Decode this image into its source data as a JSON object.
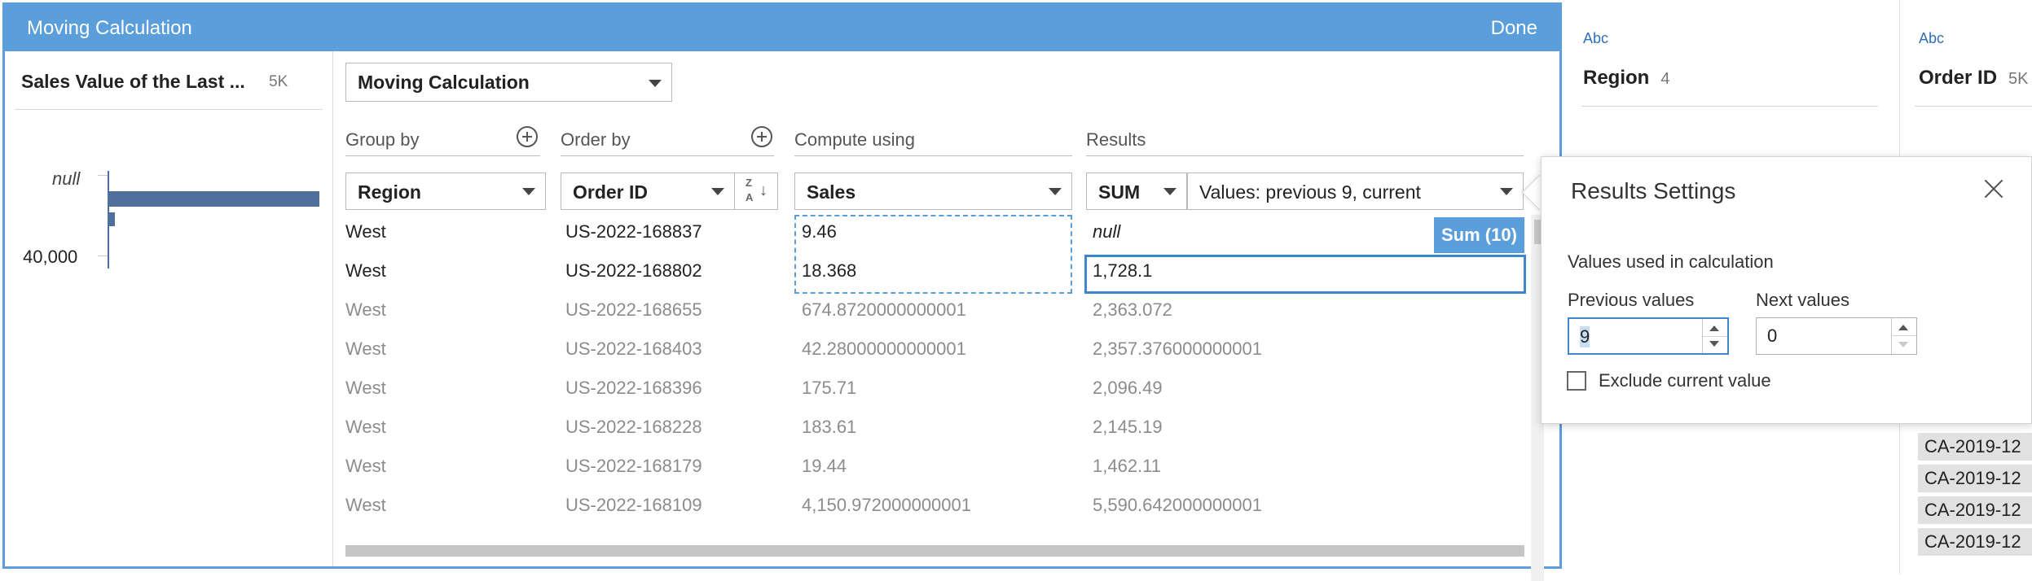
{
  "editor": {
    "title": "Moving Calculation",
    "done_label": "Done",
    "left_panel": {
      "field_name": "Sales Value of the Last ...",
      "count": "5K",
      "null_label": "null",
      "axis_label": "40,000",
      "histogram": {
        "null_bar": 1.0,
        "bar_2": 0.025
      }
    },
    "calc_type": "Moving Calculation",
    "columns": {
      "group_by": "Group by",
      "order_by": "Order by",
      "compute_using": "Compute using",
      "results": "Results"
    },
    "dropdowns": {
      "group_by": "Region",
      "order_by": "Order ID",
      "compute_using": "Sales",
      "aggregation": "SUM",
      "values": "Values: previous 9, current"
    },
    "sort_icon": "sort-z-a-icon",
    "sort_z": "Z",
    "sort_a": "A",
    "sum_badge": "Sum (10)",
    "rows": [
      {
        "region": "West",
        "order_id": "US-2022-168837",
        "sales": "9.46",
        "result": "null"
      },
      {
        "region": "West",
        "order_id": "US-2022-168802",
        "sales": "18.368",
        "result": "1,728.1"
      },
      {
        "region": "West",
        "order_id": "US-2022-168655",
        "sales": "674.8720000000001",
        "result": "2,363.072"
      },
      {
        "region": "West",
        "order_id": "US-2022-168403",
        "sales": "42.28000000000001",
        "result": "2,357.376000000001"
      },
      {
        "region": "West",
        "order_id": "US-2022-168396",
        "sales": "175.71",
        "result": "2,096.49"
      },
      {
        "region": "West",
        "order_id": "US-2022-168228",
        "sales": "183.61",
        "result": "2,145.19"
      },
      {
        "region": "West",
        "order_id": "US-2022-168179",
        "sales": "19.44",
        "result": "1,462.11"
      },
      {
        "region": "West",
        "order_id": "US-2022-168109",
        "sales": "4,150.972000000001",
        "result": "5,590.642000000001"
      }
    ]
  },
  "background_cards": {
    "region": {
      "type": "Abc",
      "name": "Region",
      "count": "4"
    },
    "order_id": {
      "type": "Abc",
      "name": "Order ID",
      "count": "5K",
      "values": [
        "CA-2019-12",
        "CA-2019-12",
        "CA-2019-12",
        "CA-2019-12"
      ]
    }
  },
  "results_settings": {
    "title": "Results Settings",
    "section_label": "Values used in calculation",
    "previous_label": "Previous values",
    "previous_value": "9",
    "next_label": "Next values",
    "next_value": "0",
    "exclude_label": "Exclude current value",
    "exclude_checked": false
  },
  "colors": {
    "accent": "#5a9edb",
    "bar": "#4f6f9c",
    "selection_border": "#3f86cf"
  }
}
